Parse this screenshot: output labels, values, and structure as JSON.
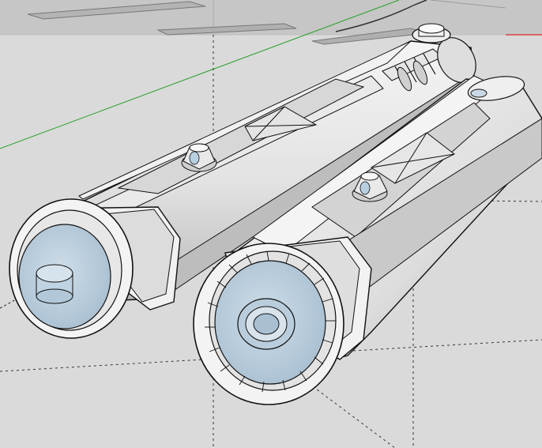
{
  "app": {
    "kind": "3D modeling viewport",
    "view": "perspective",
    "tool": "orbit"
  },
  "colors": {
    "background": "#d8d8d8",
    "ground_far": "#c9c9c9",
    "face_light": "#f0f0f0",
    "face_mid": "#dcdcdc",
    "face_shadow": "#bdbdbd",
    "face_back": "#b8cfe0",
    "edge": "#111111",
    "axis_green": "#2aa02a",
    "axis_red": "#c03030",
    "axis_blue": "#2050c0",
    "hidden_line": "#333333"
  },
  "model": {
    "parts": [
      {
        "name": "left-hilt",
        "has_emitter_knob": true,
        "has_switch_button": true,
        "has_grip_rings": true
      },
      {
        "name": "right-hilt",
        "has_emitter_knob": false,
        "has_switch_button": true,
        "has_toothed_emitter": true
      }
    ]
  }
}
